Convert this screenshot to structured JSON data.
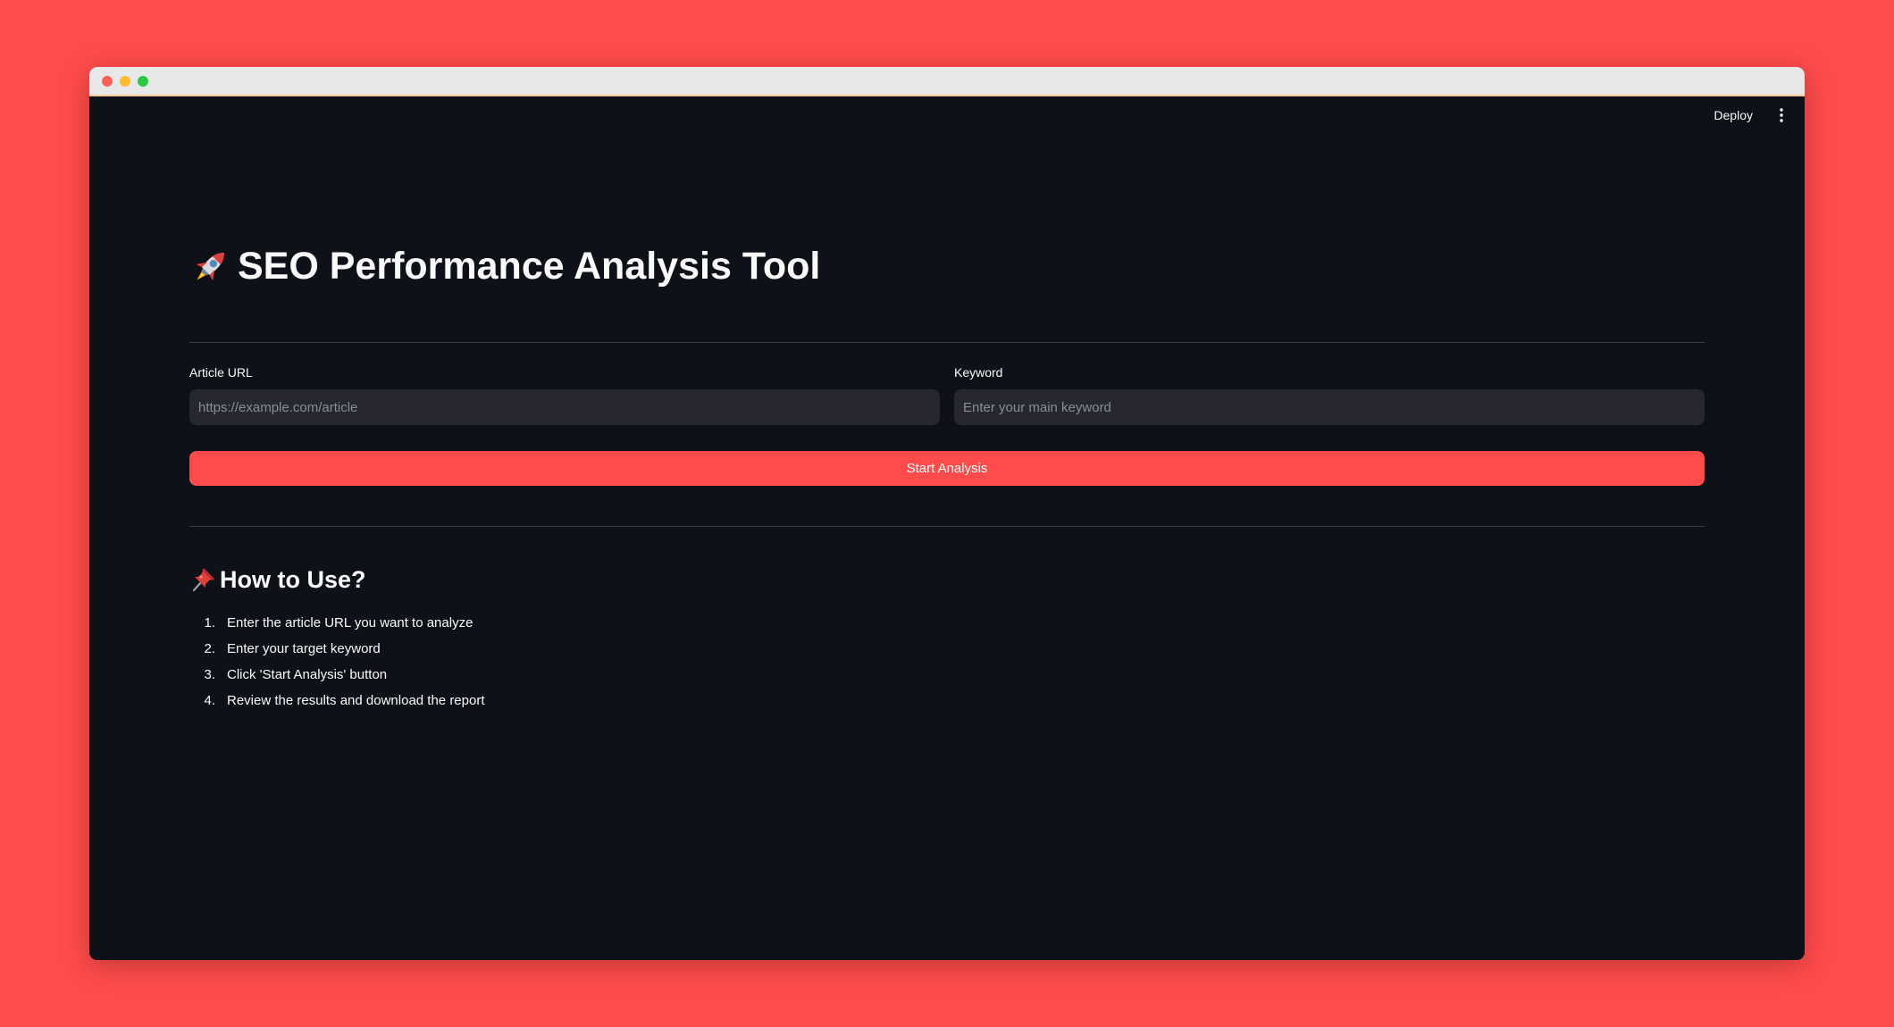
{
  "app": {
    "title": "SEO Performance Analysis Tool",
    "title_icon": "rocket-icon",
    "deploy_label": "Deploy",
    "menu_icon": "vertical-dots-icon"
  },
  "form": {
    "url": {
      "label": "Article URL",
      "placeholder": "https://example.com/article",
      "value": ""
    },
    "keyword": {
      "label": "Keyword",
      "placeholder": "Enter your main keyword",
      "value": ""
    },
    "submit_label": "Start Analysis"
  },
  "howto": {
    "heading": "How to Use?",
    "heading_icon": "pushpin-icon",
    "steps": [
      {
        "num": "1.",
        "text": "Enter the article URL you want to analyze"
      },
      {
        "num": "2.",
        "text": "Enter your target keyword"
      },
      {
        "num": "3.",
        "text": "Click 'Start Analysis' button"
      },
      {
        "num": "4.",
        "text": "Review the results and download the report"
      }
    ]
  },
  "colors": {
    "background": "#ff4b4b",
    "app_bg": "#0e1117",
    "input_bg": "#262730",
    "primary": "#ff4b4b",
    "text": "#fafafa"
  }
}
